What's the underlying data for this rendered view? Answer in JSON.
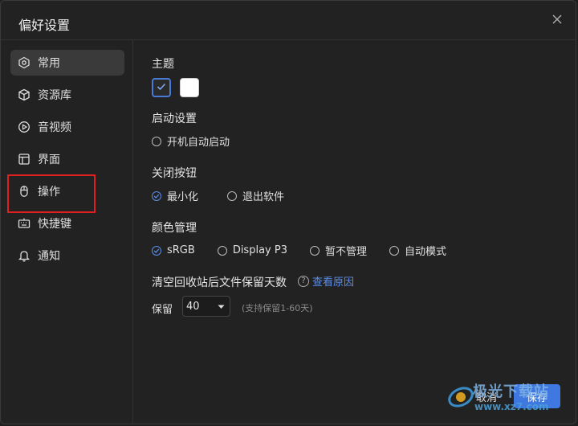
{
  "dialog": {
    "title": "偏好设置"
  },
  "sidebar": {
    "items": [
      {
        "label": "常用",
        "icon": "hexagon-icon"
      },
      {
        "label": "资源库",
        "icon": "cube-icon"
      },
      {
        "label": "音视频",
        "icon": "play-circle-icon"
      },
      {
        "label": "界面",
        "icon": "layout-icon"
      },
      {
        "label": "操作",
        "icon": "mouse-icon"
      },
      {
        "label": "快捷键",
        "icon": "keyboard-icon"
      },
      {
        "label": "通知",
        "icon": "bell-icon"
      }
    ],
    "active_index": 0
  },
  "content": {
    "theme": {
      "label": "主题",
      "options": [
        "dark",
        "light"
      ],
      "selected": "dark"
    },
    "startup": {
      "label": "启动设置",
      "option": "开机自动启动",
      "checked": false
    },
    "close_button": {
      "label": "关闭按钮",
      "options": [
        "最小化",
        "退出软件"
      ],
      "selected": 0
    },
    "color": {
      "label": "颜色管理",
      "options": [
        "sRGB",
        "Display P3",
        "暂不管理",
        "自动模式"
      ],
      "selected": 0
    },
    "recycle": {
      "label": "清空回收站后文件保留天数",
      "help_link": "查看原因",
      "retain_label": "保留",
      "retain_value": "40",
      "hint": "(支持保留1-60天)"
    }
  },
  "footer": {
    "cancel": "取消",
    "save": "保存"
  },
  "watermark": {
    "text": "极光下载站",
    "url": "www.xz7.com"
  },
  "colors": {
    "accent": "#3f78e0",
    "highlight": "#e02020",
    "background": "#222222"
  }
}
